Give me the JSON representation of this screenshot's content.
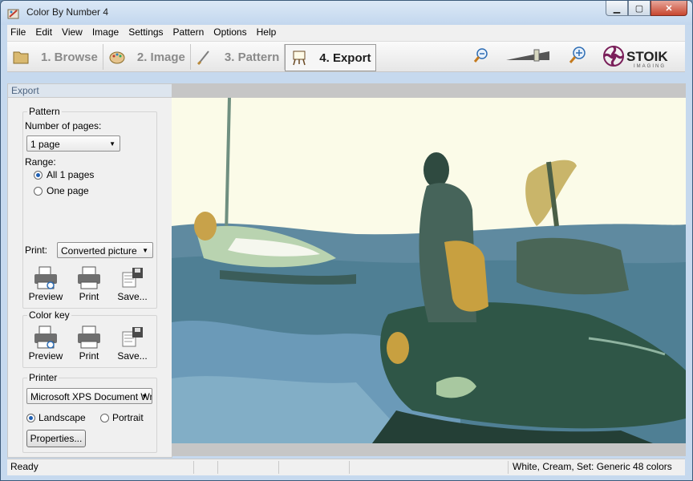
{
  "window": {
    "title": "Color By Number 4"
  },
  "menu": [
    "File",
    "Edit",
    "View",
    "Image",
    "Settings",
    "Pattern",
    "Options",
    "Help"
  ],
  "steps": [
    {
      "label": "1. Browse",
      "icon": "folder-icon",
      "active": false
    },
    {
      "label": "2. Image",
      "icon": "palette-icon",
      "active": false
    },
    {
      "label": "3. Pattern",
      "icon": "brush-icon",
      "active": false
    },
    {
      "label": "4. Export",
      "icon": "easel-icon",
      "active": true
    }
  ],
  "logo": {
    "brand": "STOIK",
    "sub": "IMAGING"
  },
  "zoom": {
    "level": 0.7
  },
  "panel": {
    "header": "Export",
    "pattern": {
      "title": "Pattern",
      "pages_label": "Number of pages:",
      "pages_value": "1 page",
      "range_label": "Range:",
      "range_all": "All 1 pages",
      "range_one": "One page",
      "print_label": "Print:",
      "print_value": "Converted picture",
      "buttons": [
        "Preview",
        "Print",
        "Save..."
      ]
    },
    "color_key": {
      "title": "Color key",
      "buttons": [
        "Preview",
        "Print",
        "Save..."
      ]
    },
    "printer": {
      "title": "Printer",
      "value": "Microsoft XPS Document Wri",
      "landscape": "Landscape",
      "portrait": "Portrait",
      "properties": "Properties..."
    }
  },
  "status": {
    "left": "Ready",
    "right": "White, Cream,  Set: Generic 48 colors"
  },
  "colors": {
    "accent": "#1e5fb4",
    "logo": "#7a1f5a"
  }
}
